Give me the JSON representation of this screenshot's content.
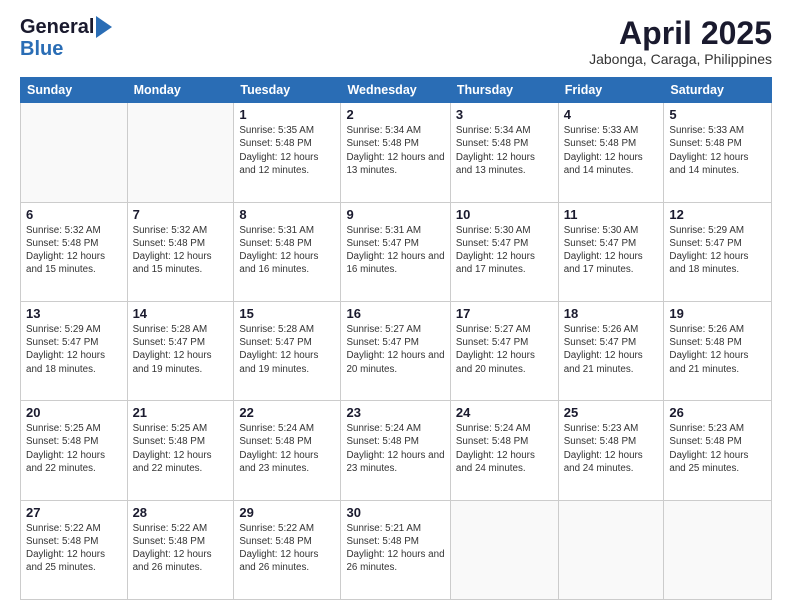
{
  "header": {
    "logo_general": "General",
    "logo_blue": "Blue",
    "month_title": "April 2025",
    "location": "Jabonga, Caraga, Philippines"
  },
  "weekdays": [
    "Sunday",
    "Monday",
    "Tuesday",
    "Wednesday",
    "Thursday",
    "Friday",
    "Saturday"
  ],
  "days": [
    {
      "num": "",
      "sunrise": "",
      "sunset": "",
      "daylight": ""
    },
    {
      "num": "",
      "sunrise": "",
      "sunset": "",
      "daylight": ""
    },
    {
      "num": "1",
      "sunrise": "Sunrise: 5:35 AM",
      "sunset": "Sunset: 5:48 PM",
      "daylight": "Daylight: 12 hours and 12 minutes."
    },
    {
      "num": "2",
      "sunrise": "Sunrise: 5:34 AM",
      "sunset": "Sunset: 5:48 PM",
      "daylight": "Daylight: 12 hours and 13 minutes."
    },
    {
      "num": "3",
      "sunrise": "Sunrise: 5:34 AM",
      "sunset": "Sunset: 5:48 PM",
      "daylight": "Daylight: 12 hours and 13 minutes."
    },
    {
      "num": "4",
      "sunrise": "Sunrise: 5:33 AM",
      "sunset": "Sunset: 5:48 PM",
      "daylight": "Daylight: 12 hours and 14 minutes."
    },
    {
      "num": "5",
      "sunrise": "Sunrise: 5:33 AM",
      "sunset": "Sunset: 5:48 PM",
      "daylight": "Daylight: 12 hours and 14 minutes."
    },
    {
      "num": "6",
      "sunrise": "Sunrise: 5:32 AM",
      "sunset": "Sunset: 5:48 PM",
      "daylight": "Daylight: 12 hours and 15 minutes."
    },
    {
      "num": "7",
      "sunrise": "Sunrise: 5:32 AM",
      "sunset": "Sunset: 5:48 PM",
      "daylight": "Daylight: 12 hours and 15 minutes."
    },
    {
      "num": "8",
      "sunrise": "Sunrise: 5:31 AM",
      "sunset": "Sunset: 5:48 PM",
      "daylight": "Daylight: 12 hours and 16 minutes."
    },
    {
      "num": "9",
      "sunrise": "Sunrise: 5:31 AM",
      "sunset": "Sunset: 5:47 PM",
      "daylight": "Daylight: 12 hours and 16 minutes."
    },
    {
      "num": "10",
      "sunrise": "Sunrise: 5:30 AM",
      "sunset": "Sunset: 5:47 PM",
      "daylight": "Daylight: 12 hours and 17 minutes."
    },
    {
      "num": "11",
      "sunrise": "Sunrise: 5:30 AM",
      "sunset": "Sunset: 5:47 PM",
      "daylight": "Daylight: 12 hours and 17 minutes."
    },
    {
      "num": "12",
      "sunrise": "Sunrise: 5:29 AM",
      "sunset": "Sunset: 5:47 PM",
      "daylight": "Daylight: 12 hours and 18 minutes."
    },
    {
      "num": "13",
      "sunrise": "Sunrise: 5:29 AM",
      "sunset": "Sunset: 5:47 PM",
      "daylight": "Daylight: 12 hours and 18 minutes."
    },
    {
      "num": "14",
      "sunrise": "Sunrise: 5:28 AM",
      "sunset": "Sunset: 5:47 PM",
      "daylight": "Daylight: 12 hours and 19 minutes."
    },
    {
      "num": "15",
      "sunrise": "Sunrise: 5:28 AM",
      "sunset": "Sunset: 5:47 PM",
      "daylight": "Daylight: 12 hours and 19 minutes."
    },
    {
      "num": "16",
      "sunrise": "Sunrise: 5:27 AM",
      "sunset": "Sunset: 5:47 PM",
      "daylight": "Daylight: 12 hours and 20 minutes."
    },
    {
      "num": "17",
      "sunrise": "Sunrise: 5:27 AM",
      "sunset": "Sunset: 5:47 PM",
      "daylight": "Daylight: 12 hours and 20 minutes."
    },
    {
      "num": "18",
      "sunrise": "Sunrise: 5:26 AM",
      "sunset": "Sunset: 5:47 PM",
      "daylight": "Daylight: 12 hours and 21 minutes."
    },
    {
      "num": "19",
      "sunrise": "Sunrise: 5:26 AM",
      "sunset": "Sunset: 5:48 PM",
      "daylight": "Daylight: 12 hours and 21 minutes."
    },
    {
      "num": "20",
      "sunrise": "Sunrise: 5:25 AM",
      "sunset": "Sunset: 5:48 PM",
      "daylight": "Daylight: 12 hours and 22 minutes."
    },
    {
      "num": "21",
      "sunrise": "Sunrise: 5:25 AM",
      "sunset": "Sunset: 5:48 PM",
      "daylight": "Daylight: 12 hours and 22 minutes."
    },
    {
      "num": "22",
      "sunrise": "Sunrise: 5:24 AM",
      "sunset": "Sunset: 5:48 PM",
      "daylight": "Daylight: 12 hours and 23 minutes."
    },
    {
      "num": "23",
      "sunrise": "Sunrise: 5:24 AM",
      "sunset": "Sunset: 5:48 PM",
      "daylight": "Daylight: 12 hours and 23 minutes."
    },
    {
      "num": "24",
      "sunrise": "Sunrise: 5:24 AM",
      "sunset": "Sunset: 5:48 PM",
      "daylight": "Daylight: 12 hours and 24 minutes."
    },
    {
      "num": "25",
      "sunrise": "Sunrise: 5:23 AM",
      "sunset": "Sunset: 5:48 PM",
      "daylight": "Daylight: 12 hours and 24 minutes."
    },
    {
      "num": "26",
      "sunrise": "Sunrise: 5:23 AM",
      "sunset": "Sunset: 5:48 PM",
      "daylight": "Daylight: 12 hours and 25 minutes."
    },
    {
      "num": "27",
      "sunrise": "Sunrise: 5:22 AM",
      "sunset": "Sunset: 5:48 PM",
      "daylight": "Daylight: 12 hours and 25 minutes."
    },
    {
      "num": "28",
      "sunrise": "Sunrise: 5:22 AM",
      "sunset": "Sunset: 5:48 PM",
      "daylight": "Daylight: 12 hours and 26 minutes."
    },
    {
      "num": "29",
      "sunrise": "Sunrise: 5:22 AM",
      "sunset": "Sunset: 5:48 PM",
      "daylight": "Daylight: 12 hours and 26 minutes."
    },
    {
      "num": "30",
      "sunrise": "Sunrise: 5:21 AM",
      "sunset": "Sunset: 5:48 PM",
      "daylight": "Daylight: 12 hours and 26 minutes."
    },
    {
      "num": "",
      "sunrise": "",
      "sunset": "",
      "daylight": ""
    },
    {
      "num": "",
      "sunrise": "",
      "sunset": "",
      "daylight": ""
    },
    {
      "num": "",
      "sunrise": "",
      "sunset": "",
      "daylight": ""
    }
  ]
}
